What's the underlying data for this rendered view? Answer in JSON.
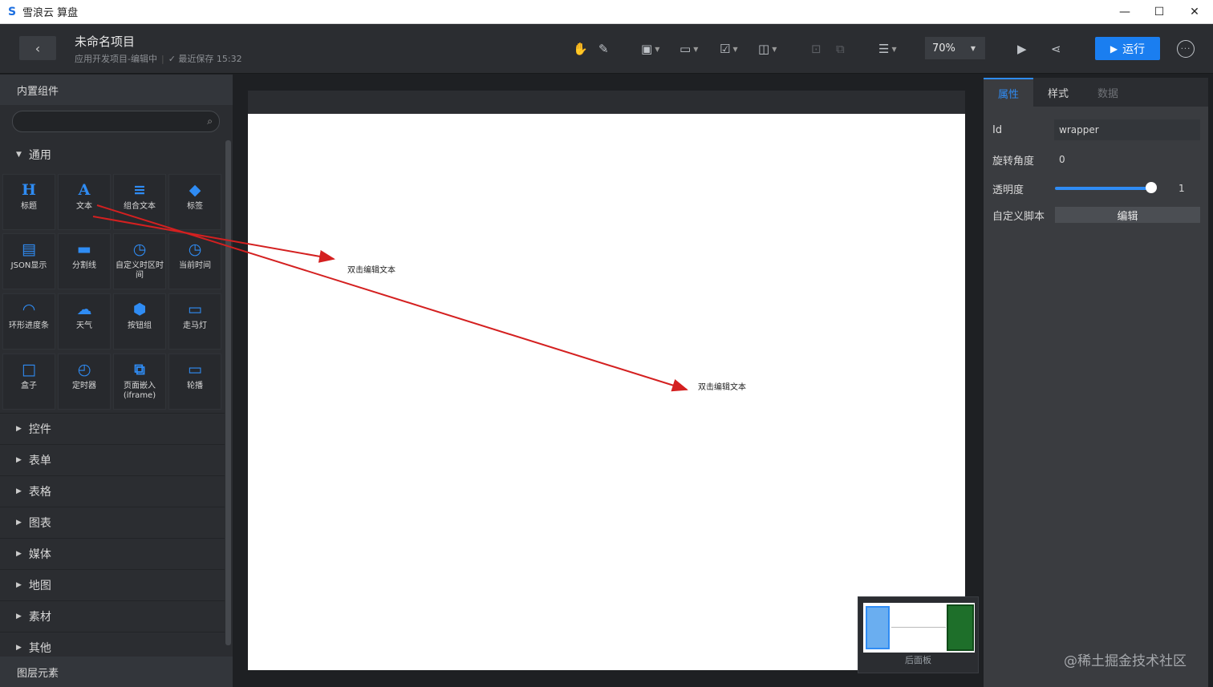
{
  "window": {
    "app_title": "雪浪云 算盘",
    "minimize": "—",
    "maximize": "☐",
    "close": "✕"
  },
  "header": {
    "project_name": "未命名项目",
    "project_type": "应用开发项目-编辑中",
    "save_status": "最近保存 15:32",
    "zoom": "70%",
    "run_label": "运行"
  },
  "left_panel": {
    "title": "内置组件",
    "search_placeholder": "",
    "open_category": "通用",
    "components": [
      {
        "label": "标题",
        "icon": "H"
      },
      {
        "label": "文本",
        "icon": "A"
      },
      {
        "label": "组合文本",
        "icon": "≡"
      },
      {
        "label": "标签",
        "icon": "◆"
      },
      {
        "label": "JSON显示",
        "icon": "▤"
      },
      {
        "label": "分割线",
        "icon": "▬"
      },
      {
        "label": "自定义时区时间",
        "icon": "◷"
      },
      {
        "label": "当前时间",
        "icon": "◷"
      },
      {
        "label": "环形进度条",
        "icon": "◠"
      },
      {
        "label": "天气",
        "icon": "☁"
      },
      {
        "label": "按钮组",
        "icon": "⬢"
      },
      {
        "label": "走马灯",
        "icon": "▭"
      },
      {
        "label": "盒子",
        "icon": "□"
      },
      {
        "label": "定时器",
        "icon": "◴"
      },
      {
        "label": "页面嵌入(iframe)",
        "icon": "⧉"
      },
      {
        "label": "轮播",
        "icon": "▭"
      }
    ],
    "categories": [
      "控件",
      "表单",
      "表格",
      "图表",
      "媒体",
      "地图",
      "素材",
      "其他"
    ],
    "bottom_title": "图层元素"
  },
  "canvas": {
    "text1": "双击编辑文本",
    "text2": "双击编辑文本",
    "minimap_label": "后面板"
  },
  "right_panel": {
    "tabs": [
      "属性",
      "样式",
      "数据"
    ],
    "active_tab": "属性",
    "props": {
      "id_label": "Id",
      "id_value": "wrapper",
      "rotation_label": "旋转角度",
      "rotation_value": "0",
      "opacity_label": "透明度",
      "opacity_value": "1",
      "script_label": "自定义脚本",
      "script_button": "编辑"
    }
  },
  "watermark": "@稀土掘金技术社区"
}
